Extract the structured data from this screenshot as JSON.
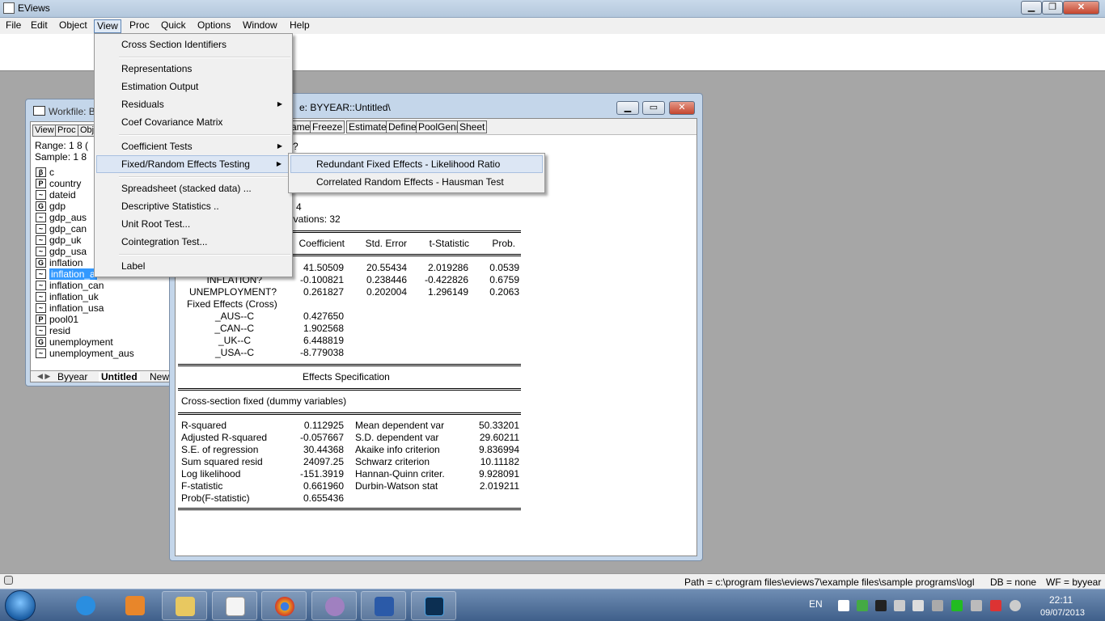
{
  "app": {
    "title": "EViews"
  },
  "menubar": [
    "File",
    "Edit",
    "Object",
    "View",
    "Proc",
    "Quick",
    "Options",
    "Window",
    "Help"
  ],
  "workfile": {
    "title": "Workfile: B",
    "buttons": [
      "View",
      "Proc",
      "Obj"
    ],
    "range": "Range:  1 8 (",
    "sample": "Sample: 1 8",
    "objects": [
      {
        "icon": "β",
        "name": "c"
      },
      {
        "icon": "P",
        "name": "country"
      },
      {
        "icon": "~",
        "name": "dateid"
      },
      {
        "icon": "G",
        "name": "gdp"
      },
      {
        "icon": "~",
        "name": "gdp_aus"
      },
      {
        "icon": "~",
        "name": "gdp_can"
      },
      {
        "icon": "~",
        "name": "gdp_uk"
      },
      {
        "icon": "~",
        "name": "gdp_usa"
      },
      {
        "icon": "G",
        "name": "inflation"
      },
      {
        "icon": "~",
        "name": "inflation_a"
      },
      {
        "icon": "~",
        "name": "inflation_can"
      },
      {
        "icon": "~",
        "name": "inflation_uk"
      },
      {
        "icon": "~",
        "name": "inflation_usa"
      },
      {
        "icon": "P",
        "name": "pool01"
      },
      {
        "icon": "~",
        "name": "resid"
      },
      {
        "icon": "G",
        "name": "unemployment"
      },
      {
        "icon": "~",
        "name": "unemployment_aus"
      }
    ],
    "tabs": [
      "Byyear",
      "Untitled",
      "New"
    ]
  },
  "pool": {
    "title": "e: BYYEAR::Untitled\\",
    "buttons": [
      "ame",
      "Freeze",
      "Estimate",
      "Define",
      "PoolGenr",
      "Sheet"
    ],
    "partial_lines": [
      "?",
      "4",
      "servations: 32"
    ],
    "headers": [
      "Coefficient",
      "Std. Error",
      "t-Statistic",
      "Prob."
    ],
    "rows": [
      {
        "var": "",
        "coef": "41.50509",
        "se": "20.55434",
        "t": "2.019286",
        "p": "0.0539"
      },
      {
        "var": "INFLATION?",
        "coef": "-0.100821",
        "se": "0.238446",
        "t": "-0.422826",
        "p": "0.6759"
      },
      {
        "var": "UNEMPLOYMENT?",
        "coef": "0.261827",
        "se": "0.202004",
        "t": "1.296149",
        "p": "0.2063"
      }
    ],
    "fixed_effects_label": "Fixed Effects (Cross)",
    "fixed_effects": [
      {
        "var": "_AUS--C",
        "coef": "0.427650"
      },
      {
        "var": "_CAN--C",
        "coef": "1.902568"
      },
      {
        "var": "_UK--C",
        "coef": "6.448819"
      },
      {
        "var": "_USA--C",
        "coef": "-8.779038"
      }
    ],
    "effects_spec_title": "Effects Specification",
    "effects_spec": "Cross-section fixed (dummy variables)",
    "stats": [
      {
        "l1": "R-squared",
        "v1": "0.112925",
        "l2": "Mean dependent var",
        "v2": "50.33201"
      },
      {
        "l1": "Adjusted R-squared",
        "v1": "-0.057667",
        "l2": "S.D. dependent var",
        "v2": "29.60211"
      },
      {
        "l1": "S.E. of regression",
        "v1": "30.44368",
        "l2": "Akaike info criterion",
        "v2": "9.836994"
      },
      {
        "l1": "Sum squared resid",
        "v1": "24097.25",
        "l2": "Schwarz criterion",
        "v2": "10.11182"
      },
      {
        "l1": "Log likelihood",
        "v1": "-151.3919",
        "l2": "Hannan-Quinn criter.",
        "v2": "9.928091"
      },
      {
        "l1": "F-statistic",
        "v1": "0.661960",
        "l2": "Durbin-Watson stat",
        "v2": "2.019211"
      },
      {
        "l1": "Prob(F-statistic)",
        "v1": "0.655436",
        "l2": "",
        "v2": ""
      }
    ]
  },
  "view_menu": {
    "items": [
      "Cross Section Identifiers",
      "Representations",
      "Estimation Output",
      "Residuals",
      "Coef Covariance Matrix",
      "Coefficient Tests",
      "Fixed/Random Effects Testing",
      "Spreadsheet (stacked data) ...",
      "Descriptive Statistics ..",
      "Unit Root Test...",
      "Cointegration Test...",
      "Label"
    ],
    "submenu": [
      "Redundant Fixed Effects - Likelihood Ratio",
      "Correlated Random Effects - Hausman Test"
    ]
  },
  "status": {
    "path": "Path = c:\\program files\\eviews7\\example files\\sample programs\\logl",
    "db": "DB = none",
    "wf": "WF = byyear"
  },
  "taskbar": {
    "lang": "EN",
    "time": "22:11",
    "date": "09/07/2013"
  },
  "colors": {
    "selection": "#3399ff",
    "taskbar": "#4f6f99"
  }
}
